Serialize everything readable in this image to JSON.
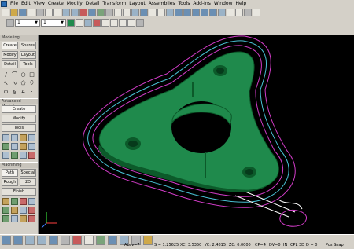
{
  "menu": [
    "File",
    "Edit",
    "View",
    "Create",
    "Modify",
    "Detail",
    "Transform",
    "Layout",
    "Assemblies",
    "Tools",
    "Add-Ins",
    "Window",
    "Help"
  ],
  "toolbar": {
    "layer_value": "1",
    "level_value": "1"
  },
  "left_panel": {
    "modeling": {
      "title": "Modeling",
      "buttons": [
        [
          "Create",
          "Shares"
        ],
        [
          "Modify",
          "Layout"
        ],
        [
          "Detail",
          "Tools"
        ]
      ]
    },
    "advanced": {
      "title": "Advanced Modeling",
      "buttons": [
        "Create",
        "Modify",
        "Tools"
      ]
    },
    "machining": {
      "title": "Machining",
      "buttons": [
        [
          "Path",
          "Special"
        ],
        [
          "Rough",
          "2D"
        ],
        [
          "Finish"
        ]
      ]
    }
  },
  "status": {
    "alev": "ALev=7",
    "scale": "S = 1.25625",
    "xc": "XC: 3.5350",
    "yc": "YC: 2.4815",
    "zc": "ZC: 0.0000",
    "cp": "CP=4",
    "dv": "DV=0",
    "in": "IN",
    "cpl": "CPL",
    "d3": "3D",
    "d0": "D = 0",
    "snap": "Pos Snap"
  },
  "colors": {
    "part": "#1f8a4c",
    "part_dark": "#0c5a2a",
    "toolpath_magenta": "#d23cc8",
    "toolpath_cyan": "#49c3d6",
    "toolpath_white": "#ffffff",
    "viewport_bg": "#000000"
  }
}
